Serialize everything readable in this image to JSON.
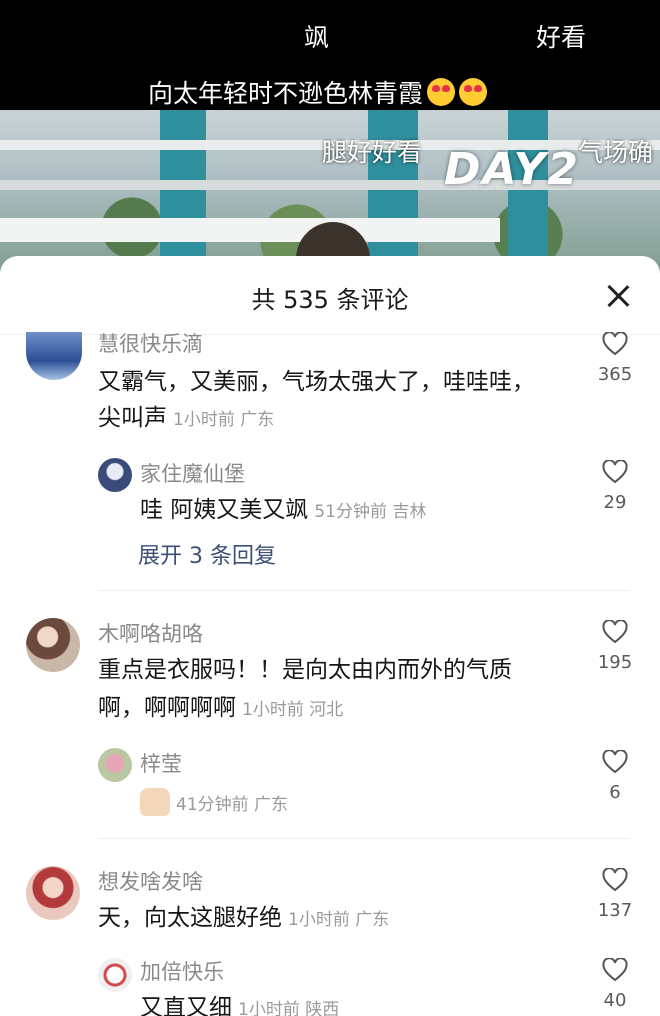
{
  "video": {
    "danmu": [
      {
        "text": "飒"
      },
      {
        "text": "好看"
      },
      {
        "text": "向太年轻时不逊色林青霞"
      },
      {
        "text": "腿好好看"
      },
      {
        "text": "气场确"
      }
    ],
    "overlay_text": "DAY2"
  },
  "sheet": {
    "title": "共 535 条评论",
    "close_icon": "close-icon"
  },
  "comments": [
    {
      "username": "慧很快乐滴",
      "text": "又霸气，又美丽，气场太强大了，哇哇哇，",
      "text2": "尖叫声",
      "meta": "1小时前 广东",
      "likes": "365",
      "replies": [
        {
          "username": "家住魔仙堡",
          "text": "哇 阿姨又美又飒",
          "meta": "51分钟前 吉林",
          "likes": "29"
        }
      ],
      "expand": "展开 3 条回复"
    },
    {
      "username": "木啊咯胡咯",
      "text": "重点是衣服吗！！是向太由内而外的气质",
      "text2": "啊，啊啊啊啊",
      "meta": "1小时前 河北",
      "likes": "195",
      "replies": [
        {
          "username": "梓莹",
          "text": "",
          "meta": "41分钟前 广东",
          "likes": "6"
        }
      ]
    },
    {
      "username": "想发啥发啥",
      "text": "天，向太这腿好绝",
      "meta": "1小时前 广东",
      "likes": "137",
      "replies": [
        {
          "username": "加倍快乐",
          "text": "又直又细",
          "meta": "1小时前 陕西",
          "likes": "40"
        }
      ]
    }
  ]
}
